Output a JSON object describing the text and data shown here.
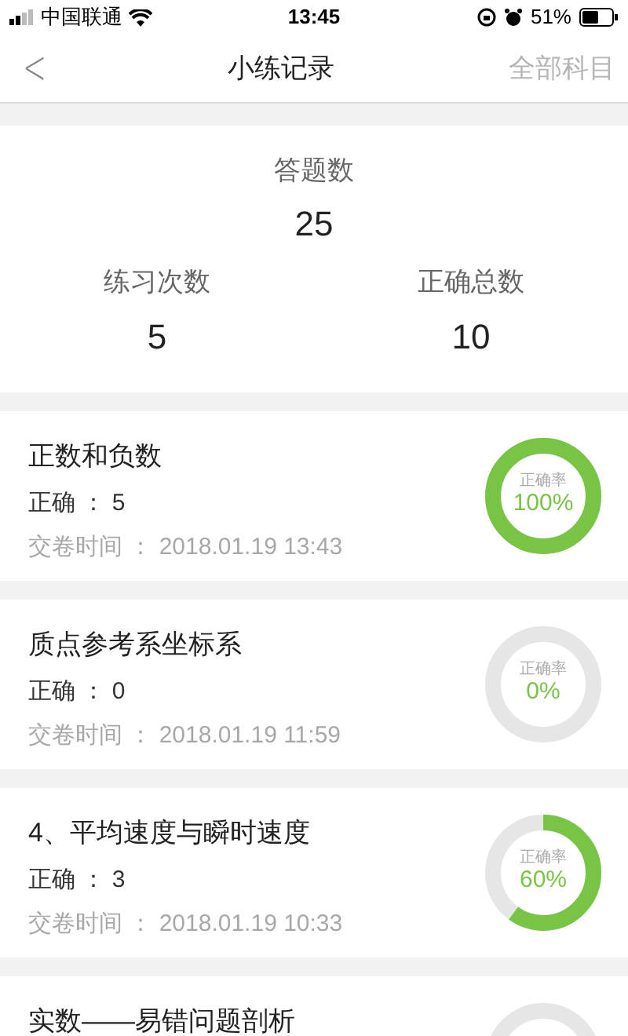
{
  "status_bar": {
    "carrier": "中国联通",
    "time": "13:45",
    "battery": "51%"
  },
  "nav": {
    "back": "<",
    "title": "小练记录",
    "action": "全部科目"
  },
  "summary": {
    "main": {
      "label": "答题数",
      "value": "25"
    },
    "stats": [
      {
        "label": "练习次数",
        "value": "5"
      },
      {
        "label": "正确总数",
        "value": "10"
      }
    ]
  },
  "records": [
    {
      "title": "正数和负数",
      "correct": "正确 ： 5",
      "time": "交卷时间 ： 2018.01.19 13:43",
      "rate_label": "正确率",
      "rate": "100%",
      "level": 1
    },
    {
      "title": "质点参考系坐标系",
      "correct": "正确 ： 0",
      "time": "交卷时间 ： 2018.01.19 11:59",
      "rate_label": "正确率",
      "rate": "0%",
      "level": 0
    },
    {
      "title": "4、平均速度与瞬时速度",
      "correct": "正确 ： 3",
      "time": "交卷时间 ： 2018.01.19 10:33",
      "rate_label": "正确率",
      "rate": "60%",
      "level": 0.6
    },
    {
      "title": "实数——易错问题剖析",
      "level": 0
    }
  ]
}
